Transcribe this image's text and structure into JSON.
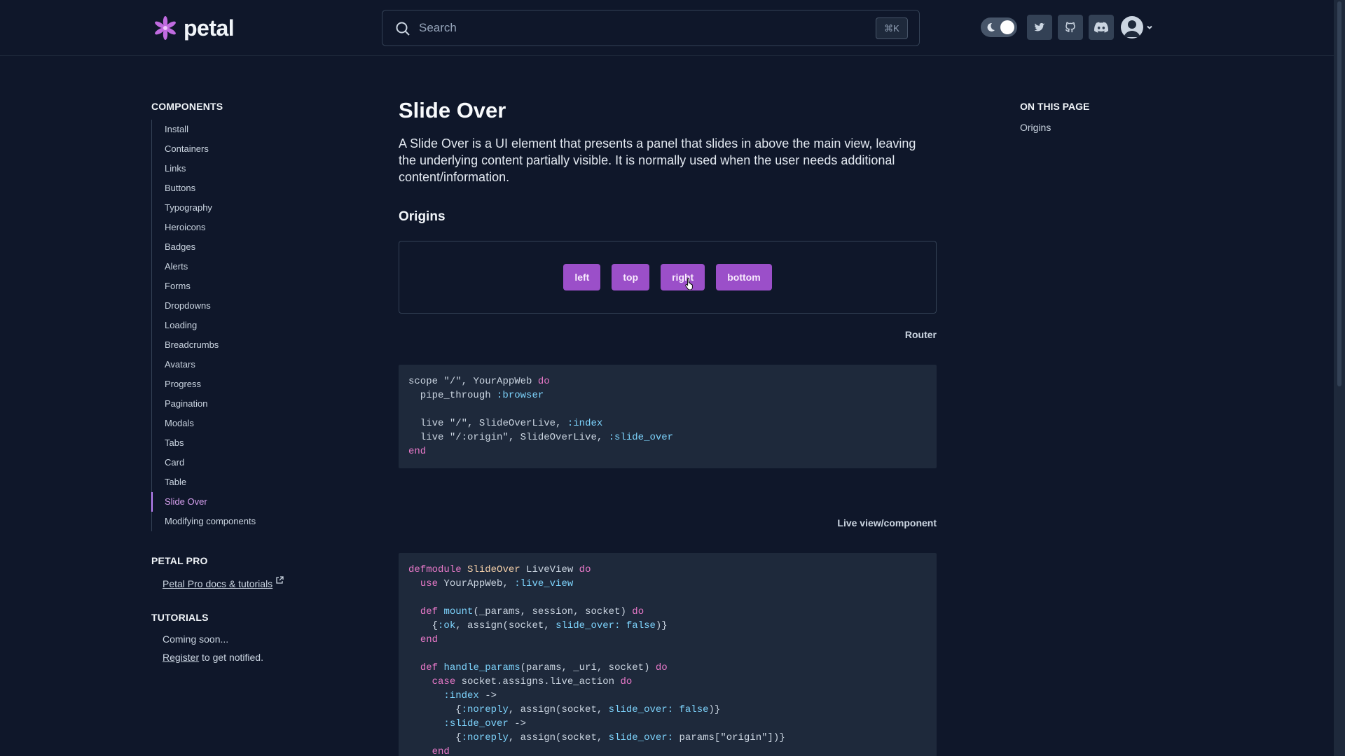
{
  "header": {
    "brand": "petal",
    "search_placeholder": "Search",
    "search_shortcut": "⌘K",
    "icons": [
      "theme-toggle",
      "twitter-icon",
      "github-icon",
      "discord-icon",
      "user-avatar",
      "chevron-down-icon"
    ]
  },
  "sidebar": {
    "components_heading": "COMPONENTS",
    "items": [
      {
        "label": "Install"
      },
      {
        "label": "Containers"
      },
      {
        "label": "Links"
      },
      {
        "label": "Buttons"
      },
      {
        "label": "Typography"
      },
      {
        "label": "Heroicons"
      },
      {
        "label": "Badges"
      },
      {
        "label": "Alerts"
      },
      {
        "label": "Forms"
      },
      {
        "label": "Dropdowns"
      },
      {
        "label": "Loading"
      },
      {
        "label": "Breadcrumbs"
      },
      {
        "label": "Avatars"
      },
      {
        "label": "Progress"
      },
      {
        "label": "Pagination"
      },
      {
        "label": "Modals"
      },
      {
        "label": "Tabs"
      },
      {
        "label": "Card"
      },
      {
        "label": "Table"
      },
      {
        "label": "Slide Over",
        "active": true
      },
      {
        "label": "Modifying components"
      }
    ],
    "petal_pro_heading": "PETAL PRO",
    "petal_pro_link": "Petal Pro docs & tutorials",
    "tutorials_heading": "TUTORIALS",
    "tutorials_coming": "Coming soon...",
    "register_link": "Register",
    "register_suffix": " to get notified."
  },
  "main": {
    "title": "Slide Over",
    "lead": "A Slide Over is a UI element that presents a panel that slides in above the main view, leaving the underlying content partially visible. It is normally used when the user needs additional content/information.",
    "origins_heading": "Origins",
    "origin_buttons": [
      "left",
      "top",
      "right",
      "bottom"
    ],
    "router_label": "Router",
    "liveview_label": "Live view/component"
  },
  "toc": {
    "heading": "ON THIS PAGE",
    "items": [
      "Origins"
    ]
  },
  "colors": {
    "background": "#0f172a",
    "accent_purple": "#9b4fc9",
    "active_link": "#d8a1f0",
    "code_bg": "#1e293b"
  }
}
